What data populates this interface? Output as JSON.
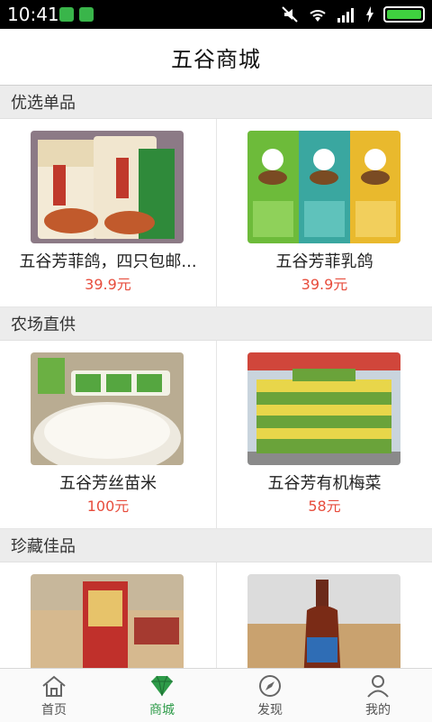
{
  "status_bar": {
    "time": "10:41"
  },
  "header": {
    "title": "五谷商城"
  },
  "sections": [
    {
      "title": "优选单品",
      "products": [
        {
          "name": "五谷芳菲鸽，四只包邮...",
          "price": "39.9元",
          "image": "packaged-pigeon"
        },
        {
          "name": "五谷芳菲乳鸽",
          "price": "39.9元",
          "image": "chef-packages"
        }
      ]
    },
    {
      "title": "农场直供",
      "products": [
        {
          "name": "五谷芳丝苗米",
          "price": "100元",
          "image": "rice-bowl"
        },
        {
          "name": "五谷芳有机梅菜",
          "price": "58元",
          "image": "stacked-boxes"
        }
      ]
    },
    {
      "title": "珍藏佳品",
      "products": [
        {
          "name": "",
          "price": "",
          "image": "wine-box"
        },
        {
          "name": "",
          "price": "",
          "image": "wine-bottle"
        }
      ]
    }
  ],
  "tabs": [
    {
      "label": "首页",
      "icon": "home-icon"
    },
    {
      "label": "商城",
      "icon": "diamond-icon",
      "active": true
    },
    {
      "label": "发现",
      "icon": "compass-icon"
    },
    {
      "label": "我的",
      "icon": "user-icon"
    }
  ],
  "colors": {
    "price": "#e74c3c",
    "active_tab": "#2e9b49"
  }
}
